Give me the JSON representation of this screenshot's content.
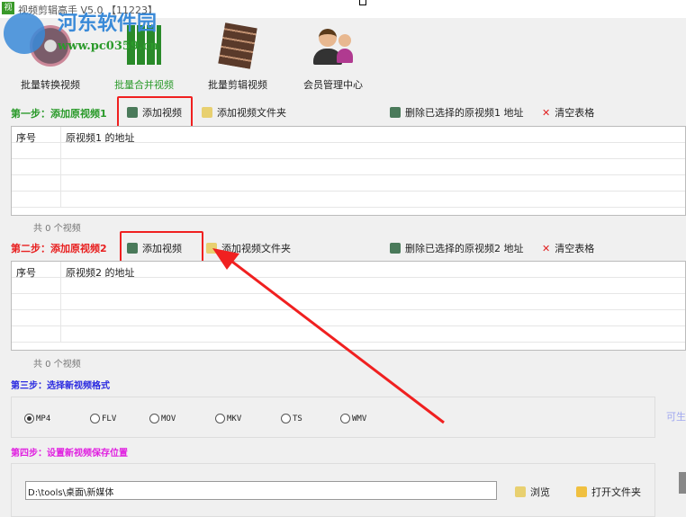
{
  "window": {
    "title": "视频剪辑高手 V5.0 【11223】",
    "icon": "app-icon"
  },
  "watermark": {
    "name": "河东软件园",
    "url": "www.pc0359.cn"
  },
  "toolbar": [
    {
      "label": "批量转换视频",
      "icon": "film-reel-icon",
      "active": false
    },
    {
      "label": "批量合并视频",
      "icon": "merge-grid-icon",
      "active": true
    },
    {
      "label": "批量剪辑视频",
      "icon": "film-scissors-icon",
      "active": false
    },
    {
      "label": "会员管理中心",
      "icon": "users-icon",
      "active": false
    }
  ],
  "step1": {
    "label": "第一步：添加原视频1",
    "add_video": "添加视频",
    "add_folder": "添加视频文件夹",
    "delete": "删除已选择的原视频1 地址",
    "clear": "清空表格",
    "col_index": "序号",
    "col_path": "原视频1 的地址",
    "count": "共 0 个视频"
  },
  "step2": {
    "label": "第二步：添加原视频2",
    "add_video": "添加视频",
    "add_folder": "添加视频文件夹",
    "delete": "删除已选择的原视频2 地址",
    "clear": "清空表格",
    "col_index": "序号",
    "col_path": "原视频2 的地址",
    "count": "共 0 个视频"
  },
  "step3": {
    "label": "第三步：选择新视频格式",
    "formats": [
      "MP4",
      "FLV",
      "MOV",
      "MKV",
      "TS",
      "WMV"
    ],
    "selected": "MP4",
    "side_text": "可生"
  },
  "step4": {
    "label": "第四步：设置新视频保存位置",
    "path": "D:\\tools\\桌面\\新媒体",
    "browse": "浏览",
    "open_folder": "打开文件夹"
  },
  "colors": {
    "step1": "#2a9a2a",
    "step2": "#e82020",
    "step3": "#2a2ae0",
    "step4": "#e020e0",
    "highlight": "#f02020"
  }
}
